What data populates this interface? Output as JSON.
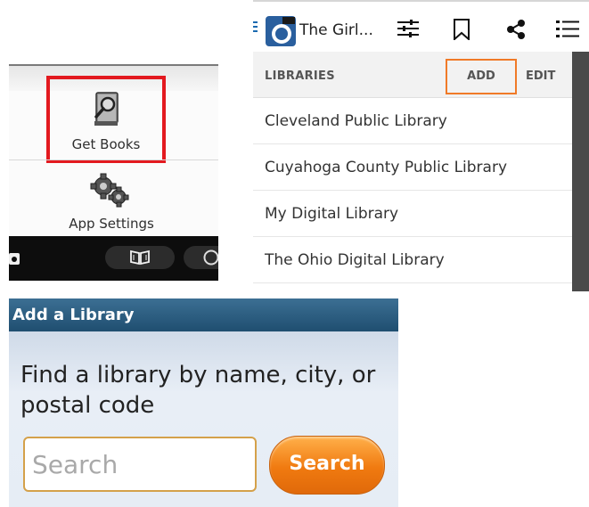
{
  "left_panel": {
    "get_books_label": "Get Books",
    "app_settings_label": "App Settings",
    "icons": [
      "book-search-icon",
      "gears-icon",
      "camera-icon",
      "open-book-icon",
      "overflow-icon"
    ]
  },
  "right_panel": {
    "app_title": "The Girl...",
    "toolbar_icons": [
      "sliders-icon",
      "bookmark-icon",
      "share-icon",
      "list-icon"
    ],
    "section_header": "LIBRARIES",
    "add_label": "ADD",
    "edit_label": "EDIT",
    "libraries": [
      "Cleveland Public Library",
      "Cuyahoga County Public Library",
      "My Digital Library",
      "The Ohio Digital Library"
    ],
    "accent_color": "#f07a28"
  },
  "dialog": {
    "title": "Add a Library",
    "prompt": "Find a library by name, city, or postal code",
    "search_placeholder": "Search",
    "search_button_label": "Search",
    "button_color": "#f07a10"
  }
}
